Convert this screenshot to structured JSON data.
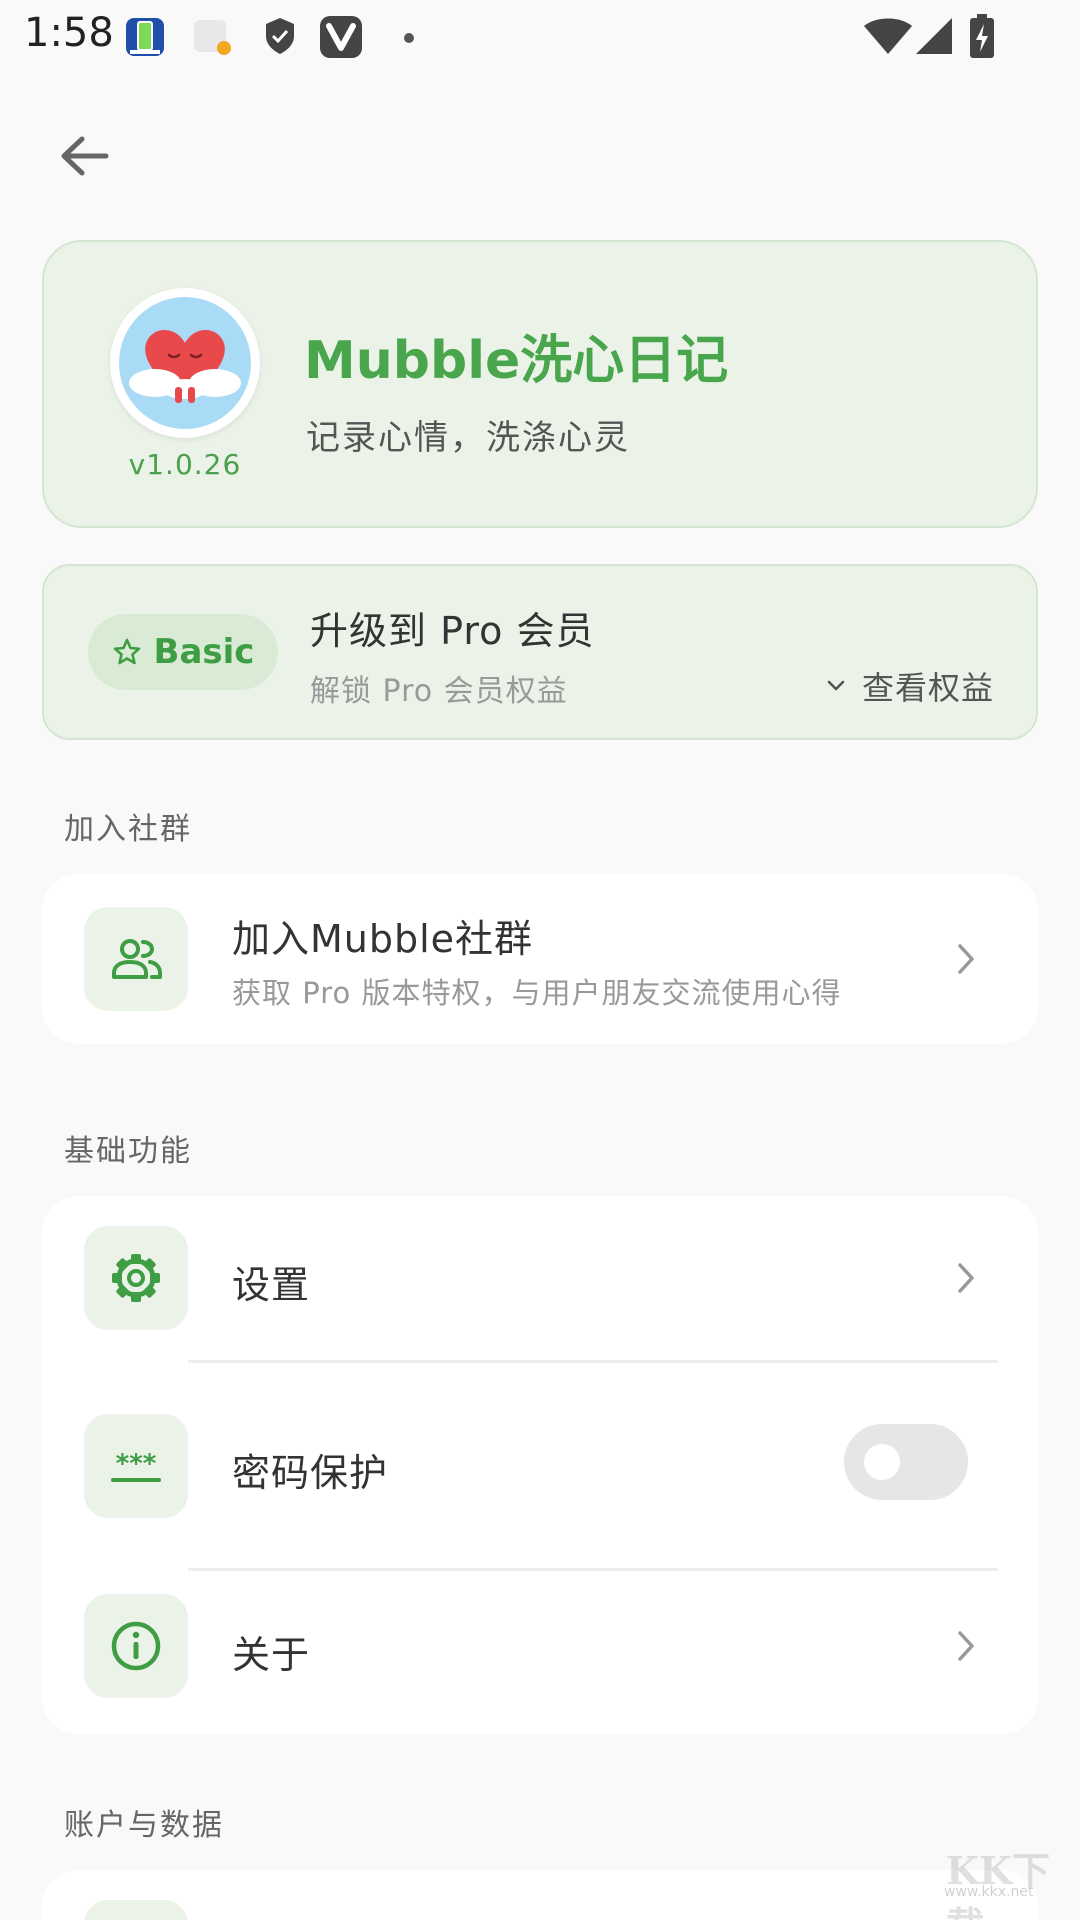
{
  "status_bar": {
    "time": "1:58"
  },
  "hero": {
    "app_name": "Mubble洗心日记",
    "tagline": "记录心情，洗涤心灵",
    "version": "v1.0.26"
  },
  "pro": {
    "badge": "Basic",
    "title": "升级到 Pro 会员",
    "subtitle": "解锁 Pro 会员权益",
    "benefits_label": "查看权益"
  },
  "sections": {
    "community": {
      "label": "加入社群",
      "item_title": "加入Mubble社群",
      "item_subtitle": "获取 Pro 版本特权，与用户朋友交流使用心得"
    },
    "basic": {
      "label": "基础功能",
      "settings": "设置",
      "password": "密码保护",
      "password_enabled": false,
      "about": "关于"
    },
    "account": {
      "label": "账户与数据"
    }
  },
  "watermark": {
    "big": "KK下载",
    "small": "www.kkx.net"
  },
  "colors": {
    "accent": "#4aa64d",
    "card_tint": "#ebf3e9",
    "background": "#f9f9f9"
  }
}
